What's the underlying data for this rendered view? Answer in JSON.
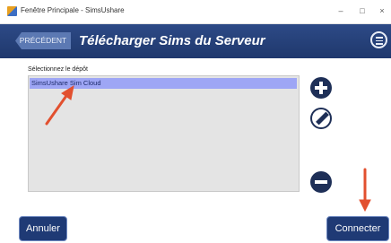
{
  "window": {
    "title": "Fenêtre Principale - SimsUshare",
    "minimize_glyph": "–",
    "maximize_glyph": "□",
    "close_glyph": "×"
  },
  "header": {
    "back_label": "PRÉCÉDENT",
    "title": "Télécharger Sims du Serveur",
    "menu_icon": "hamburger-menu-icon"
  },
  "depot": {
    "label": "Sélectionnez le dépôt",
    "items": [
      {
        "label": "SimsUshare Sim Cloud",
        "selected": true
      }
    ]
  },
  "side_actions": {
    "add_icon": "plus-circle-icon",
    "edit_icon": "pencil-icon",
    "remove_icon": "minus-circle-icon"
  },
  "footer": {
    "cancel_label": "Annuler",
    "connect_label": "Connecter"
  },
  "annotations": {
    "arrow_color": "#e2502f"
  },
  "colors": {
    "header_bg": "#2d4a86",
    "list_bg": "#e4e4e4",
    "selected_item_bg": "#9ea6f5",
    "button_bg": "#1f3a75"
  }
}
